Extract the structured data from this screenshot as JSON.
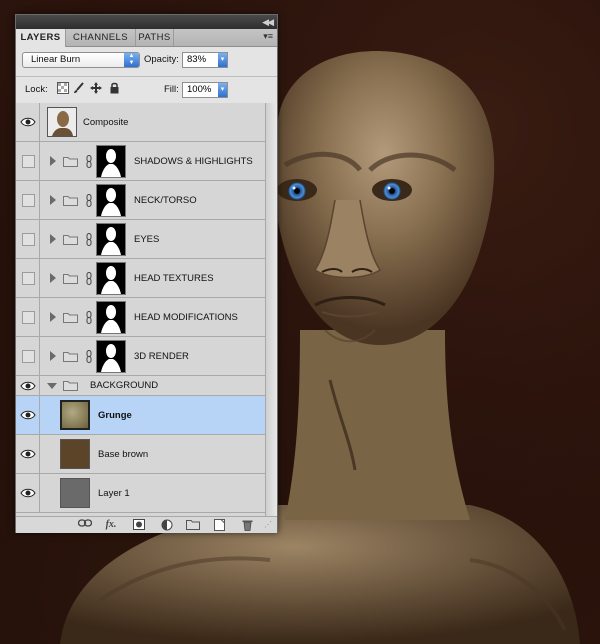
{
  "panel": {
    "tabs": [
      {
        "label": "LAYERS",
        "active": true
      },
      {
        "label": "CHANNELS",
        "active": false
      },
      {
        "label": "PATHS",
        "active": false
      }
    ],
    "blend_mode": "Linear Burn",
    "opacity_label": "Opacity:",
    "opacity_value": "83%",
    "lock_label": "Lock:",
    "fill_label": "Fill:",
    "fill_value": "100%"
  },
  "layers": [
    {
      "name": "Composite",
      "type": "layer",
      "visible": true,
      "thumb_color": "#8a6a44"
    },
    {
      "name": "SHADOWS & HIGHLIGHTS",
      "type": "group",
      "visible": false,
      "expanded": false,
      "has_mask": true
    },
    {
      "name": "NECK/TORSO",
      "type": "group",
      "visible": false,
      "expanded": false,
      "has_mask": true
    },
    {
      "name": "EYES",
      "type": "group",
      "visible": false,
      "expanded": false,
      "has_mask": true
    },
    {
      "name": "HEAD TEXTURES",
      "type": "group",
      "visible": false,
      "expanded": false,
      "has_mask": true
    },
    {
      "name": "HEAD MODIFICATIONS",
      "type": "group",
      "visible": false,
      "expanded": false,
      "has_mask": true
    },
    {
      "name": "3D RENDER",
      "type": "group",
      "visible": false,
      "expanded": false,
      "has_mask": true
    },
    {
      "name": "BACKGROUND",
      "type": "group",
      "visible": true,
      "expanded": true,
      "has_mask": false
    },
    {
      "name": "Grunge",
      "type": "layer",
      "visible": true,
      "selected": true,
      "thumb_color": "#8f8660"
    },
    {
      "name": "Base brown",
      "type": "layer",
      "visible": true,
      "thumb_color": "#5b4427"
    },
    {
      "name": "Layer 1",
      "type": "layer",
      "visible": true,
      "thumb_color": "#6a6a6a"
    }
  ],
  "footer_icons": [
    "link-layers-icon",
    "layer-style-fx-icon",
    "add-mask-icon",
    "adjustment-layer-icon",
    "new-group-icon",
    "new-layer-icon",
    "delete-layer-icon"
  ],
  "colors": {
    "selection": "#b7d3f6",
    "panel_bg": "#d8d8d8",
    "accent_blue": "#2f6fd1",
    "background_dark": "#1c0c07"
  }
}
